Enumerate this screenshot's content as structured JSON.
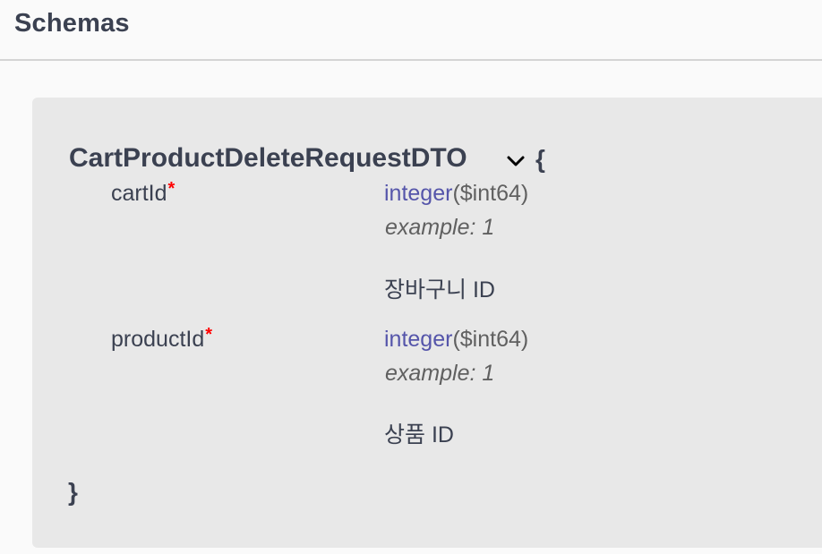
{
  "section": {
    "title": "Schemas"
  },
  "model": {
    "name": "CartProductDeleteRequestDTO",
    "toggle_icon": "chevron-down-icon",
    "brace_open": "{",
    "brace_close": "}",
    "properties": [
      {
        "name": "cartId",
        "required_mark": "*",
        "type": "integer",
        "format": "($int64)",
        "example": "example: 1",
        "description": "장바구니 ID"
      },
      {
        "name": "productId",
        "required_mark": "*",
        "type": "integer",
        "format": "($int64)",
        "example": "example: 1",
        "description": "상품 ID"
      }
    ]
  },
  "colors": {
    "header_background": "#fafafa",
    "model_background": "#e8e8e8",
    "text": "#3b4151",
    "type_name": "#55a",
    "muted": "#606060",
    "required": "#ff0000"
  }
}
